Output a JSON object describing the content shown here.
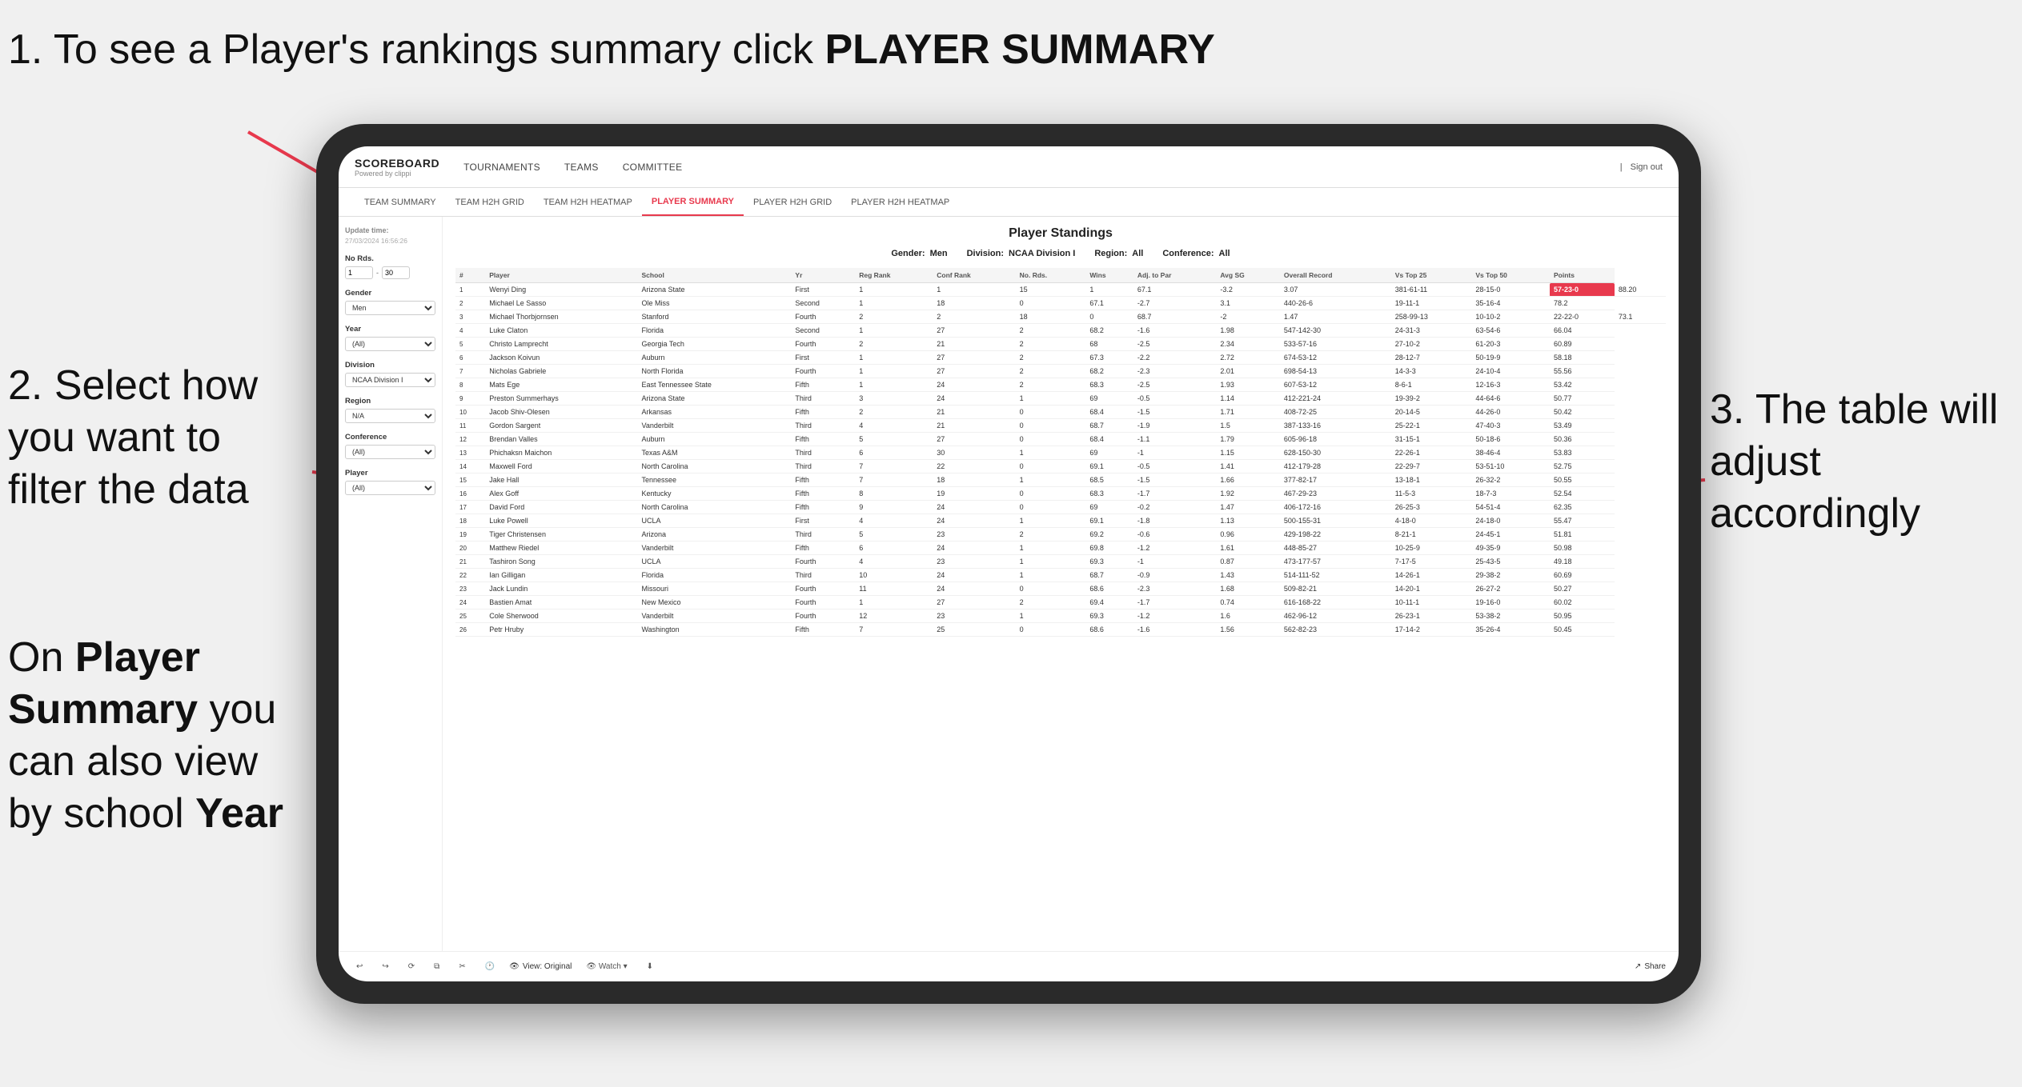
{
  "annotations": {
    "step1": {
      "number": "1.",
      "text": "To see a Player's rankings summary click ",
      "bold": "PLAYER SUMMARY"
    },
    "step2": {
      "number": "2.",
      "text": "Select how you want to filter the data"
    },
    "step3_right": "3. The table will adjust accordingly",
    "step_bottom": {
      "text": "On ",
      "bold1": "Player Summary",
      "text2": " you can also view by school ",
      "bold2": "Year"
    }
  },
  "nav": {
    "logo": "SCOREBOARD",
    "logo_sub": "Powered by clippi",
    "links": [
      "TOURNAMENTS",
      "TEAMS",
      "COMMITTEE"
    ],
    "sign_out": "Sign out"
  },
  "sub_nav": {
    "links": [
      "TEAM SUMMARY",
      "TEAM H2H GRID",
      "TEAM H2H HEATMAP",
      "PLAYER SUMMARY",
      "PLAYER H2H GRID",
      "PLAYER H2H HEATMAP"
    ]
  },
  "sidebar": {
    "update_label": "Update time:",
    "update_time": "27/03/2024 16:56:26",
    "filters": {
      "no_rds_label": "No Rds.",
      "gender_label": "Gender",
      "gender_value": "Men",
      "year_label": "Year",
      "year_value": "(All)",
      "division_label": "Division",
      "division_value": "NCAA Division I",
      "region_label": "Region",
      "region_value": "N/A",
      "conference_label": "Conference",
      "conference_value": "(All)",
      "player_label": "Player",
      "player_value": "(All)"
    }
  },
  "table": {
    "title": "Player Standings",
    "gender_label": "Gender:",
    "gender_value": "Men",
    "division_label": "Division:",
    "division_value": "NCAA Division I",
    "region_label": "Region:",
    "region_value": "All",
    "conference_label": "Conference:",
    "conference_value": "All",
    "headers": [
      "#",
      "Player",
      "School",
      "Yr",
      "Reg Rank",
      "Conf Rank",
      "No. Rds.",
      "Wins",
      "Adj. to Par",
      "Avg SG",
      "Overall Record",
      "Vs Top 25",
      "Vs Top 50",
      "Points"
    ],
    "rows": [
      [
        1,
        "Wenyi Ding",
        "Arizona State",
        "First",
        1,
        1,
        15,
        1,
        67.1,
        -3.2,
        3.07,
        "381-61-11",
        "28-15-0",
        "57-23-0",
        "88.20"
      ],
      [
        2,
        "Michael Le Sasso",
        "Ole Miss",
        "Second",
        1,
        18,
        0,
        67.1,
        -2.7,
        3.1,
        "440-26-6",
        "19-11-1",
        "35-16-4",
        "78.2"
      ],
      [
        3,
        "Michael Thorbjornsen",
        "Stanford",
        "Fourth",
        2,
        2,
        18,
        0,
        68.7,
        -2.0,
        1.47,
        "258-99-13",
        "10-10-2",
        "22-22-0",
        "73.1"
      ],
      [
        4,
        "Luke Claton",
        "Florida",
        "Second",
        1,
        27,
        2,
        68.2,
        -1.6,
        1.98,
        "547-142-30",
        "24-31-3",
        "63-54-6",
        "66.04"
      ],
      [
        5,
        "Christo Lamprecht",
        "Georgia Tech",
        "Fourth",
        2,
        21,
        2,
        68.0,
        -2.5,
        2.34,
        "533-57-16",
        "27-10-2",
        "61-20-3",
        "60.89"
      ],
      [
        6,
        "Jackson Koivun",
        "Auburn",
        "First",
        1,
        27,
        2,
        67.3,
        -2.2,
        2.72,
        "674-53-12",
        "28-12-7",
        "50-19-9",
        "58.18"
      ],
      [
        7,
        "Nicholas Gabriele",
        "North Florida",
        "Fourth",
        1,
        27,
        2,
        68.2,
        -2.3,
        2.01,
        "698-54-13",
        "14-3-3",
        "24-10-4",
        "55.56"
      ],
      [
        8,
        "Mats Ege",
        "East Tennessee State",
        "Fifth",
        1,
        24,
        2,
        68.3,
        -2.5,
        1.93,
        "607-53-12",
        "8-6-1",
        "12-16-3",
        "53.42"
      ],
      [
        9,
        "Preston Summerhays",
        "Arizona State",
        "Third",
        3,
        24,
        1,
        69.0,
        -0.5,
        1.14,
        "412-221-24",
        "19-39-2",
        "44-64-6",
        "50.77"
      ],
      [
        10,
        "Jacob Shiv-Olesen",
        "Arkansas",
        "Fifth",
        2,
        21,
        0,
        68.4,
        -1.5,
        1.71,
        "408-72-25",
        "20-14-5",
        "44-26-0",
        "50.42"
      ],
      [
        11,
        "Gordon Sargent",
        "Vanderbilt",
        "Third",
        4,
        21,
        0,
        68.7,
        -1.9,
        1.5,
        "387-133-16",
        "25-22-1",
        "47-40-3",
        "53.49"
      ],
      [
        12,
        "Brendan Valles",
        "Auburn",
        "Fifth",
        5,
        27,
        0,
        68.4,
        -1.1,
        1.79,
        "605-96-18",
        "31-15-1",
        "50-18-6",
        "50.36"
      ],
      [
        13,
        "Phichaksn Maichon",
        "Texas A&M",
        "Third",
        6,
        30,
        1,
        69.0,
        -1.0,
        1.15,
        "628-150-30",
        "22-26-1",
        "38-46-4",
        "53.83"
      ],
      [
        14,
        "Maxwell Ford",
        "North Carolina",
        "Third",
        7,
        22,
        0,
        69.1,
        -0.5,
        1.41,
        "412-179-28",
        "22-29-7",
        "53-51-10",
        "52.75"
      ],
      [
        15,
        "Jake Hall",
        "Tennessee",
        "Fifth",
        7,
        18,
        1,
        68.5,
        -1.5,
        1.66,
        "377-82-17",
        "13-18-1",
        "26-32-2",
        "50.55"
      ],
      [
        16,
        "Alex Goff",
        "Kentucky",
        "Fifth",
        8,
        19,
        0,
        68.3,
        -1.7,
        1.92,
        "467-29-23",
        "11-5-3",
        "18-7-3",
        "52.54"
      ],
      [
        17,
        "David Ford",
        "North Carolina",
        "Fifth",
        9,
        24,
        0,
        69.0,
        -0.2,
        1.47,
        "406-172-16",
        "26-25-3",
        "54-51-4",
        "62.35"
      ],
      [
        18,
        "Luke Powell",
        "UCLA",
        "First",
        4,
        24,
        1,
        69.1,
        -1.8,
        1.13,
        "500-155-31",
        "4-18-0",
        "24-18-0",
        "55.47"
      ],
      [
        19,
        "Tiger Christensen",
        "Arizona",
        "Third",
        5,
        23,
        2,
        69.2,
        -0.6,
        0.96,
        "429-198-22",
        "8-21-1",
        "24-45-1",
        "51.81"
      ],
      [
        20,
        "Matthew Riedel",
        "Vanderbilt",
        "Fifth",
        6,
        24,
        1,
        69.8,
        -1.2,
        1.61,
        "448-85-27",
        "10-25-9",
        "49-35-9",
        "50.98"
      ],
      [
        21,
        "Tashiron Song",
        "UCLA",
        "Fourth",
        4,
        23,
        1,
        69.3,
        -1.0,
        0.87,
        "473-177-57",
        "7-17-5",
        "25-43-5",
        "49.18"
      ],
      [
        22,
        "Ian Gilligan",
        "Florida",
        "Third",
        10,
        24,
        1,
        68.7,
        -0.9,
        1.43,
        "514-111-52",
        "14-26-1",
        "29-38-2",
        "60.69"
      ],
      [
        23,
        "Jack Lundin",
        "Missouri",
        "Fourth",
        11,
        24,
        0,
        68.6,
        -2.3,
        1.68,
        "509-82-21",
        "14-20-1",
        "26-27-2",
        "50.27"
      ],
      [
        24,
        "Bastien Amat",
        "New Mexico",
        "Fourth",
        1,
        27,
        2,
        69.4,
        -1.7,
        0.74,
        "616-168-22",
        "10-11-1",
        "19-16-0",
        "60.02"
      ],
      [
        25,
        "Cole Sherwood",
        "Vanderbilt",
        "Fourth",
        12,
        23,
        1,
        69.3,
        -1.2,
        1.6,
        "462-96-12",
        "26-23-1",
        "53-38-2",
        "50.95"
      ],
      [
        26,
        "Petr Hruby",
        "Washington",
        "Fifth",
        7,
        25,
        0,
        68.6,
        -1.6,
        1.56,
        "562-82-23",
        "17-14-2",
        "35-26-4",
        "50.45"
      ]
    ]
  },
  "toolbar": {
    "view_label": "View: Original",
    "watch_label": "Watch",
    "share_label": "Share"
  }
}
